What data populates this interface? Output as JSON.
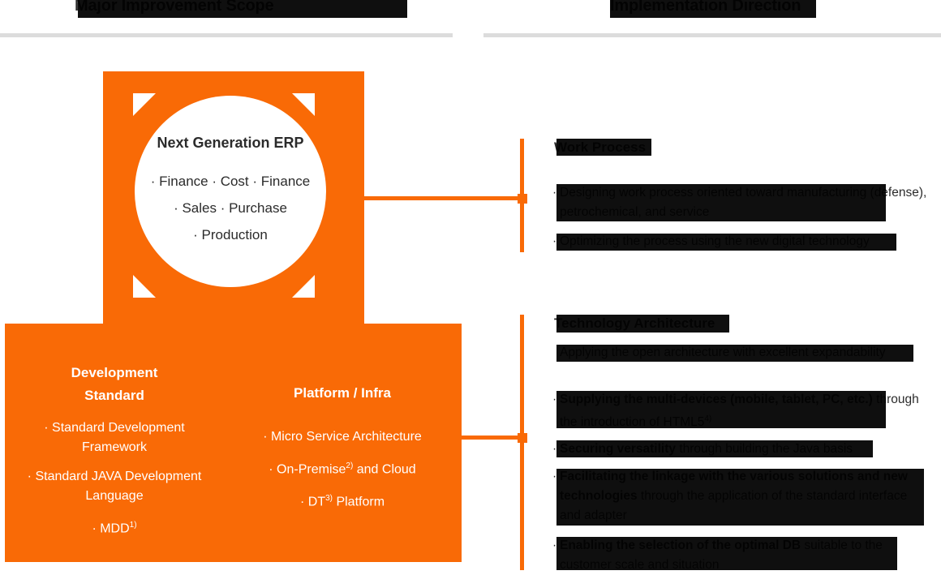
{
  "headers": {
    "left_title": "Major Improvement Scope",
    "right_title": "Implementation Direction"
  },
  "colors": {
    "orange": "#f96a06",
    "text": "#2b2b2b",
    "rule": "#dcdcdc",
    "redaction": "#0f0f0f"
  },
  "left_panel": {
    "circle": {
      "title": "Next Generation ERP",
      "lines": [
        "· Finance  · Cost  · Finance",
        "· Sales  · Purchase",
        "· Production"
      ]
    },
    "development_standard": {
      "title_line1": "Development",
      "title_line2": "Standard",
      "items": [
        "· Standard Development Framework",
        "· Standard JAVA Development Language",
        "· MDD"
      ],
      "mdd_superscript": "1)"
    },
    "platform_infra": {
      "title": "Platform / Infra",
      "items": [
        "· Micro Service Architecture",
        "· On-Premise",
        "· DT"
      ],
      "on_premise_superscript": "2)",
      "on_premise_suffix": " and Cloud",
      "dt_superscript": "3)",
      "dt_suffix": " Platform"
    }
  },
  "right_panel": {
    "work_process": {
      "heading": "Work Process",
      "bullets": [
        {
          "dot": "·",
          "text": "Designing work process oriented toward manufacturing (defense), petrochemical, and service"
        },
        {
          "dot": "·",
          "text": "Optimizing the process using the new digital technology"
        }
      ]
    },
    "technology_architecture": {
      "heading": "Technology Architecture",
      "bullets": [
        {
          "dot": "",
          "text": "Applying the open architecture with excellent expandability"
        },
        {
          "dot": "·",
          "bold": "Supplying the multi-devices (mobile, tablet, PC, etc.)",
          "rest": " through the introduction of HTML5",
          "sup": "4)"
        },
        {
          "dot": "·",
          "bold": "Securing versatility",
          "rest": " through building the Java basis",
          "sup": ""
        },
        {
          "dot": "·",
          "bold": "Facilitating the linkage with the various solutions and new technologies",
          "rest": " through the application of the standard interface and adapter",
          "sup": ""
        },
        {
          "dot": "·",
          "bold": "Enabling the selection of the optimal DB",
          "rest": " suitable to the customer scale and situation",
          "sup": ""
        }
      ]
    }
  }
}
